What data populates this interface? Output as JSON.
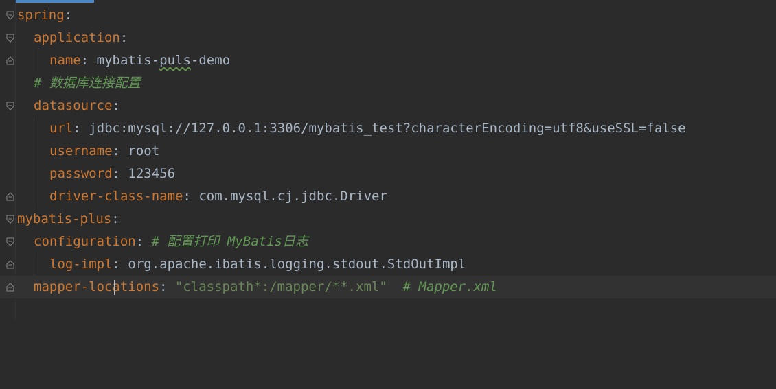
{
  "lines": [
    {
      "key": "spring",
      "colon": ":",
      "value": "",
      "comment": "",
      "string": "",
      "fold": "open"
    },
    {
      "key": "application",
      "colon": ":",
      "value": "",
      "comment": "",
      "string": "",
      "fold": "open"
    },
    {
      "key": "name",
      "colon": ": ",
      "value": "mybatis-",
      "value_typo": "puls",
      "value_rest": "-demo",
      "comment": "",
      "string": "",
      "fold": "end"
    },
    {
      "key": "",
      "colon": "",
      "value": "",
      "comment": "# 数据库连接配置",
      "string": "",
      "fold": "none"
    },
    {
      "key": "datasource",
      "colon": ":",
      "value": "",
      "comment": "",
      "string": "",
      "fold": "open"
    },
    {
      "key": "url",
      "colon": ": ",
      "value": "jdbc:mysql://127.0.0.1:3306/mybatis_test?characterEncoding=utf8&useSSL=false",
      "comment": "",
      "string": "",
      "fold": "none"
    },
    {
      "key": "username",
      "colon": ": ",
      "value": "root",
      "comment": "",
      "string": "",
      "fold": "none"
    },
    {
      "key": "password",
      "colon": ": ",
      "value": "123456",
      "comment": "",
      "string": "",
      "fold": "none"
    },
    {
      "key": "driver-class-name",
      "colon": ": ",
      "value": "com.mysql.cj.jdbc.Driver",
      "comment": "",
      "string": "",
      "fold": "end"
    },
    {
      "key": "mybatis-plus",
      "colon": ":",
      "value": "",
      "comment": "",
      "string": "",
      "fold": "open"
    },
    {
      "key": "configuration",
      "colon": ": ",
      "value": "",
      "comment": "# 配置打印 MyBatis日志",
      "string": "",
      "fold": "open"
    },
    {
      "key": "log-impl",
      "colon": ": ",
      "value": "org.apache.ibatis.logging.stdout.StdOutImpl",
      "comment": "",
      "string": "",
      "fold": "end"
    },
    {
      "key": "mapper-locations",
      "colon": ": ",
      "value": "",
      "comment": "  # Mapper.xml",
      "string": "\"classpath*:/mapper/**.xml\"",
      "fold": "end"
    }
  ],
  "colors": {
    "background": "#2b2b2b",
    "key": "#cc7832",
    "value": "#a9b7c6",
    "comment": "#629755",
    "string": "#6a8759",
    "current_line": "#323232"
  }
}
